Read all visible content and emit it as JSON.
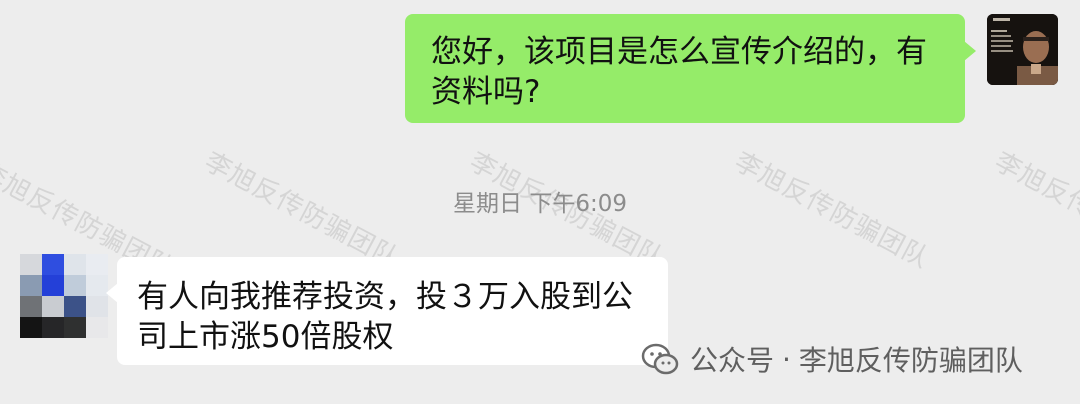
{
  "chat": {
    "outgoing": {
      "text": "您好，该项目是怎么宣传介绍的，有资料吗?"
    },
    "timestamp": "星期日 下午6:09",
    "incoming": {
      "text": "有人向我推荐投资，投３万入股到公司上市涨50倍股权"
    }
  },
  "watermark": {
    "text": "李旭反传防骗团队"
  },
  "brand": {
    "prefix": "公众号",
    "separator": "·",
    "name": "李旭反传防骗团队",
    "icon": "wechat-icon"
  },
  "colors": {
    "background": "#ededed",
    "outgoing_bubble": "#95ec69",
    "incoming_bubble": "#ffffff",
    "timestamp": "#8c8c8c"
  }
}
